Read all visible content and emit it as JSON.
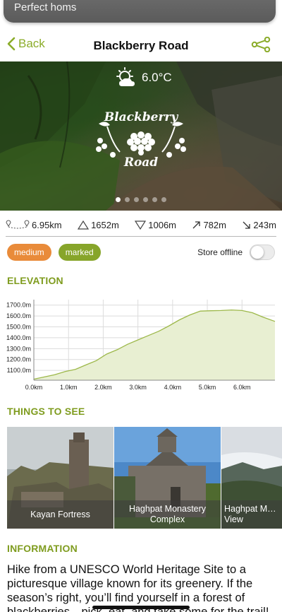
{
  "banner": {
    "text": "Perfect homs"
  },
  "nav": {
    "back_label": "Back",
    "title": "Blackberry Road"
  },
  "hero": {
    "temperature": "6.0°C",
    "weather_icon": "partly-cloudy-icon",
    "logo_word_top": "Blackberry",
    "logo_word_bottom": "Road",
    "slide_count": 6,
    "active_slide": 0
  },
  "stats": {
    "distance": "6.95km",
    "max_altitude": "1652m",
    "min_altitude": "1006m",
    "ascent": "782m",
    "descent": "243m"
  },
  "tags": {
    "difficulty": "medium",
    "marking": "marked"
  },
  "offline": {
    "label": "Store offline",
    "enabled": false
  },
  "sections": {
    "elevation": "ELEVATION",
    "things": "THINGS TO SEE",
    "information": "INFORMATION"
  },
  "chart_data": {
    "type": "area",
    "title": "",
    "xlabel": "",
    "ylabel": "",
    "x_ticks": [
      "0.0km",
      "1.0km",
      "2.0km",
      "3.0km",
      "4.0km",
      "5.0km",
      "6.0km"
    ],
    "y_ticks": [
      "1700.0m",
      "1600.0m",
      "1500.0m",
      "1400.0m",
      "1300.0m",
      "1200.0m",
      "1100.0m"
    ],
    "xlim": [
      0,
      6.95
    ],
    "ylim": [
      1010,
      1750
    ],
    "x": [
      0,
      0.3,
      0.6,
      0.9,
      1.2,
      1.5,
      1.8,
      2.1,
      2.4,
      2.7,
      3.0,
      3.3,
      3.6,
      3.9,
      4.2,
      4.5,
      4.8,
      5.1,
      5.4,
      5.7,
      6.0,
      6.3,
      6.6,
      6.95
    ],
    "y": [
      1020,
      1040,
      1060,
      1090,
      1110,
      1150,
      1190,
      1250,
      1290,
      1340,
      1380,
      1420,
      1460,
      1510,
      1565,
      1610,
      1645,
      1648,
      1650,
      1655,
      1650,
      1630,
      1590,
      1550
    ],
    "fill_color": "#e8efd2",
    "line_color": "#9db84a"
  },
  "things": [
    {
      "caption": "Kayan Fortress"
    },
    {
      "caption": "Haghpat Monastery Complex"
    },
    {
      "caption": "Haghpat M… View"
    }
  ],
  "information": {
    "lines": [
      "Hike from a UNESCO World Heritage Site to a",
      "picturesque village known for its greenery. If the",
      "season’s right, you’ll find yourself in a forest of",
      "blackberries—pick, eat, and take some for the trail!"
    ]
  },
  "colors": {
    "accent": "#8bac2a",
    "heading": "#7f9c1f",
    "medium_tag": "#e98b3a",
    "marked_tag": "#87a52a"
  }
}
